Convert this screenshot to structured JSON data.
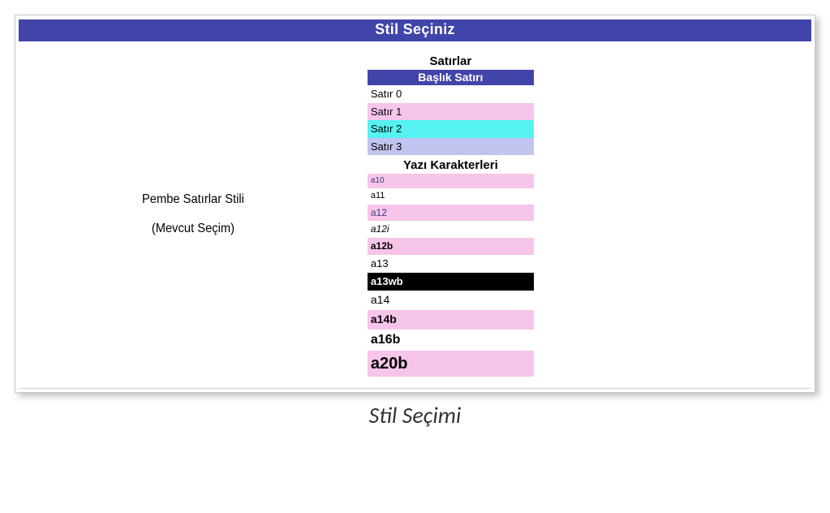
{
  "header": {
    "title": "Stil Seçiniz"
  },
  "left": {
    "style_name": "Pembe Satırlar Stili",
    "current_selection": "(Mevcut Seçim)"
  },
  "rows": {
    "section_title": "Satırlar",
    "header_row": "Başlık Satırı",
    "items": [
      {
        "label": "Satır 0",
        "bg": "bg-white"
      },
      {
        "label": "Satır 1",
        "bg": "bg-pink"
      },
      {
        "label": "Satır 2",
        "bg": "bg-cyan"
      },
      {
        "label": "Satır 3",
        "bg": "bg-lav"
      }
    ]
  },
  "fonts": {
    "section_title": "Yazı Karakterleri",
    "items": [
      {
        "label": "a10",
        "cls": "fs-a10",
        "bg": "bg-pink"
      },
      {
        "label": "a11",
        "cls": "fs-a11",
        "bg": "bg-white"
      },
      {
        "label": "a12",
        "cls": "fs-a12",
        "bg": "bg-pink"
      },
      {
        "label": "a12i",
        "cls": "fs-a12i",
        "bg": "bg-white"
      },
      {
        "label": "a12b",
        "cls": "fs-a12b",
        "bg": "bg-pink"
      },
      {
        "label": "a13",
        "cls": "fs-a13",
        "bg": "bg-white"
      },
      {
        "label": "a13wb",
        "cls": "fs-a13wb",
        "bg": "bg-black"
      },
      {
        "label": "a14",
        "cls": "fs-a14",
        "bg": "bg-white"
      },
      {
        "label": "a14b",
        "cls": "fs-a14b",
        "bg": "bg-pink"
      },
      {
        "label": "a16b",
        "cls": "fs-a16b",
        "bg": "bg-white"
      },
      {
        "label": "a20b",
        "cls": "fs-a20b",
        "bg": "bg-pink"
      }
    ]
  },
  "caption": "Stil Seçimi"
}
